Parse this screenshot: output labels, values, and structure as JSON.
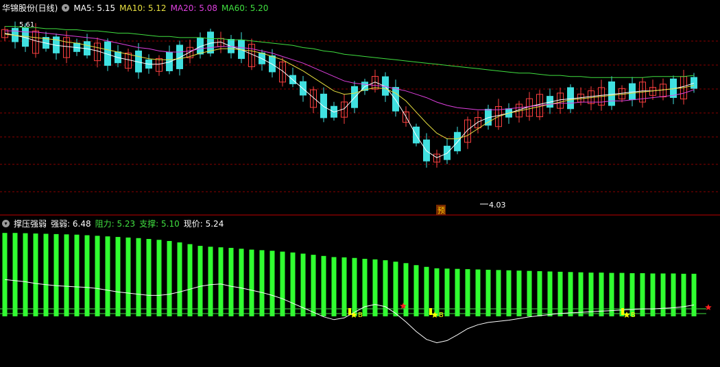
{
  "top_header": {
    "stock": "华锦股份(日线)",
    "ma5": "MA5: 5.15",
    "ma10": "MA10: 5.12",
    "ma20": "MA20: 5.08",
    "ma60": "MA60: 5.20"
  },
  "bottom_header": {
    "indicator": "撑压强弱",
    "strength": "强弱: 6.48",
    "resistance": "阻力: 5.23",
    "support": "支撑: 5.10",
    "price": "现价: 5.24"
  },
  "annotations": {
    "high_label": "5.61",
    "low_label": "4.03",
    "warn_label": "预",
    "buy_label": "B"
  },
  "colors": {
    "up": "#ff4040",
    "down": "#40e0e0",
    "ma5": "#ffffff",
    "ma10": "#e8e040",
    "ma20": "#e040e0",
    "ma60": "#40e040",
    "bars": "#30ff30",
    "grid": "#8b0000"
  },
  "chart_data": [
    {
      "type": "candlestick",
      "series": [
        {
          "name": "MA5",
          "values": [
            5.5,
            5.48,
            5.46,
            5.43,
            5.41,
            5.39,
            5.38,
            5.37,
            5.36,
            5.34,
            5.31,
            5.28,
            5.26,
            5.24,
            5.22,
            5.22,
            5.24,
            5.28,
            5.33,
            5.38,
            5.41,
            5.42,
            5.38,
            5.35,
            5.31,
            5.27,
            5.22,
            5.16,
            5.08,
            5.0,
            4.92,
            4.84,
            4.79,
            4.82,
            4.92,
            5.02,
            5.06,
            5.02,
            4.9,
            4.75,
            4.58,
            4.44,
            4.38,
            4.42,
            4.52,
            4.63,
            4.7,
            4.74,
            4.76,
            4.78,
            4.81,
            4.84,
            4.86,
            4.88,
            4.9,
            4.91,
            4.92,
            4.93,
            4.94,
            4.95,
            4.96,
            4.97,
            4.98,
            4.98,
            4.99,
            5.0,
            5.02,
            5.05
          ]
        },
        {
          "name": "MA10",
          "values": [
            5.49,
            5.48,
            5.47,
            5.46,
            5.45,
            5.44,
            5.42,
            5.41,
            5.39,
            5.37,
            5.35,
            5.33,
            5.31,
            5.29,
            5.27,
            5.26,
            5.26,
            5.27,
            5.29,
            5.32,
            5.34,
            5.36,
            5.36,
            5.35,
            5.34,
            5.32,
            5.29,
            5.26,
            5.21,
            5.16,
            5.1,
            5.04,
            4.98,
            4.95,
            4.96,
            4.99,
            5.01,
            5.0,
            4.96,
            4.89,
            4.79,
            4.69,
            4.6,
            4.55,
            4.55,
            4.58,
            4.64,
            4.7,
            4.75,
            4.78,
            4.8,
            4.82,
            4.84,
            4.86,
            4.88,
            4.9,
            4.91,
            4.92,
            4.93,
            4.94,
            4.95,
            4.96,
            4.97,
            4.98,
            4.99,
            5.0,
            5.01,
            5.03
          ]
        },
        {
          "name": "MA20",
          "values": [
            5.52,
            5.52,
            5.51,
            5.51,
            5.5,
            5.49,
            5.48,
            5.47,
            5.46,
            5.45,
            5.43,
            5.41,
            5.39,
            5.37,
            5.36,
            5.34,
            5.33,
            5.33,
            5.34,
            5.36,
            5.37,
            5.38,
            5.38,
            5.37,
            5.36,
            5.34,
            5.32,
            5.29,
            5.26,
            5.23,
            5.19,
            5.15,
            5.11,
            5.07,
            5.05,
            5.04,
            5.03,
            5.02,
            5.0,
            4.98,
            4.95,
            4.92,
            4.88,
            4.85,
            4.83,
            4.82,
            4.81,
            4.81,
            4.81,
            4.82,
            4.83,
            4.84,
            4.85,
            4.86,
            4.87,
            4.87,
            4.88,
            4.88,
            4.88,
            4.89,
            4.89,
            4.9,
            4.91,
            4.92,
            4.93,
            4.94,
            4.96,
            4.99
          ]
        },
        {
          "name": "MA60",
          "values": [
            5.56,
            5.56,
            5.55,
            5.55,
            5.54,
            5.54,
            5.53,
            5.53,
            5.52,
            5.52,
            5.51,
            5.5,
            5.5,
            5.49,
            5.48,
            5.47,
            5.47,
            5.46,
            5.46,
            5.46,
            5.45,
            5.45,
            5.44,
            5.44,
            5.43,
            5.42,
            5.41,
            5.4,
            5.39,
            5.37,
            5.36,
            5.34,
            5.33,
            5.31,
            5.3,
            5.29,
            5.28,
            5.27,
            5.26,
            5.25,
            5.24,
            5.23,
            5.22,
            5.21,
            5.2,
            5.19,
            5.18,
            5.17,
            5.16,
            5.15,
            5.14,
            5.14,
            5.13,
            5.12,
            5.12,
            5.11,
            5.11,
            5.1,
            5.1,
            5.1,
            5.1,
            5.1,
            5.1,
            5.11,
            5.11,
            5.11,
            5.11,
            5.12
          ]
        }
      ]
    },
    {
      "type": "bar",
      "series": [
        {
          "name": "强弱",
          "values": [
            7.9,
            7.9,
            7.89,
            7.88,
            7.87,
            7.86,
            7.85,
            7.84,
            7.82,
            7.8,
            7.78,
            7.76,
            7.74,
            7.72,
            7.69,
            7.66,
            7.62,
            7.57,
            7.51,
            7.45,
            7.42,
            7.4,
            7.38,
            7.35,
            7.32,
            7.3,
            7.28,
            7.25,
            7.22,
            7.18,
            7.14,
            7.1,
            7.06,
            7.05,
            7.03,
            7.0,
            6.98,
            6.95,
            6.9,
            6.85,
            6.78,
            6.72,
            6.67,
            6.66,
            6.65,
            6.64,
            6.63,
            6.62,
            6.61,
            6.6,
            6.59,
            6.58,
            6.57,
            6.56,
            6.55,
            6.54,
            6.53,
            6.52,
            6.52,
            6.51,
            6.51,
            6.5,
            6.5,
            6.49,
            6.49,
            6.49,
            6.48,
            6.48
          ]
        }
      ]
    }
  ]
}
